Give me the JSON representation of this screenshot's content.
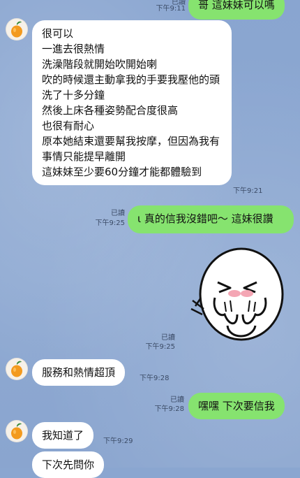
{
  "messages": [
    {
      "id": "m1",
      "side": "out",
      "text": "哥 這妹妹可以嗎",
      "read": "已讀",
      "time": "下午9:11"
    },
    {
      "id": "m2",
      "side": "in",
      "text": "很可以\n一進去很熱情\n洗澡階段就開始吹開始喇\n吹的時候還主動拿我的手要我壓他的頭\n洗了十多分鐘\n然後上床各種姿勢配合度很高\n也很有耐心\n原本她結束還要幫我按摩，但因為我有事情只能提早離開\n這妹妹至少要60分鐘才能都體驗到",
      "time": "下午9:21"
    },
    {
      "id": "m3",
      "side": "out",
      "text": "ɩ 真的信我沒錯吧～ 這妹很讚",
      "read": "已讀",
      "time": "下午9:25"
    },
    {
      "id": "m4",
      "side": "out",
      "type": "sticker",
      "sticker_name": "blushing-face-sticker",
      "read": "已讀",
      "time": "下午9:25"
    },
    {
      "id": "m5",
      "side": "in",
      "text": "服務和熱情超頂",
      "time": "下午9:28"
    },
    {
      "id": "m6",
      "side": "out",
      "text": "嘿嘿 下次要信我",
      "read": "已讀",
      "time": "下午9:28"
    },
    {
      "id": "m7",
      "side": "in",
      "text": "我知道了",
      "time": "下午9:29"
    },
    {
      "id": "m8",
      "side": "in",
      "text": "下次先問你",
      "time": ""
    }
  ],
  "colors": {
    "background": "#8aa6d0",
    "incoming": "#ffffff",
    "outgoing": "#86e36f"
  },
  "icons": {
    "avatar": "orange-fruit-avatar-icon"
  }
}
